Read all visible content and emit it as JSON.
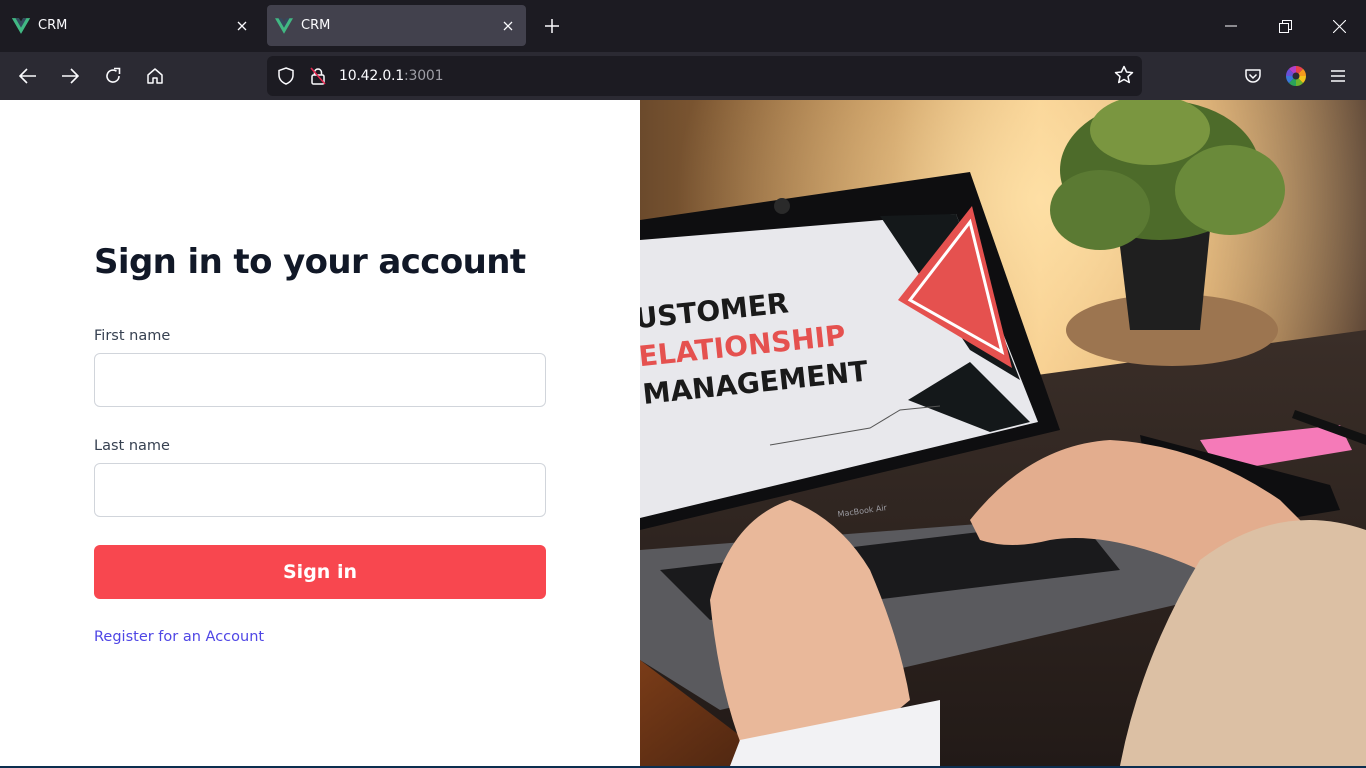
{
  "browser": {
    "tabs": [
      {
        "title": "CRM",
        "active": false,
        "icon": "vue-logo-icon"
      },
      {
        "title": "CRM",
        "active": true,
        "icon": "vue-logo-icon"
      }
    ],
    "url": {
      "host": "10.42.0.1",
      "port": ":3001"
    },
    "nav_icons": [
      "back-arrow-icon",
      "forward-arrow-icon",
      "reload-icon",
      "home-icon"
    ],
    "url_icons": [
      "tracking-shield-icon",
      "insecure-lock-icon",
      "bookmark-star-icon"
    ],
    "toolbar_icons": [
      "pocket-icon",
      "color-extension-icon",
      "hamburger-menu-icon"
    ],
    "window_controls": [
      "minimize-icon",
      "restore-icon",
      "close-icon"
    ]
  },
  "login": {
    "heading": "Sign in to your account",
    "first_name_label": "First name",
    "first_name_value": "",
    "last_name_label": "Last name",
    "last_name_value": "",
    "submit_label": "Sign in",
    "register_link": "Register for an Account"
  },
  "hero_image": {
    "alt": "Hands typing on a laptop showing a Customer Relationship Management slide",
    "screen_lines": [
      "USTOMER",
      "ELATIONSHIP",
      "MANAGEMENT"
    ],
    "laptop_label": "MacBook Air"
  },
  "colors": {
    "accent": "#f8474f",
    "link": "#4f46e5",
    "heading": "#111827",
    "vue_green": "#41b883",
    "vue_dark": "#34495e"
  }
}
